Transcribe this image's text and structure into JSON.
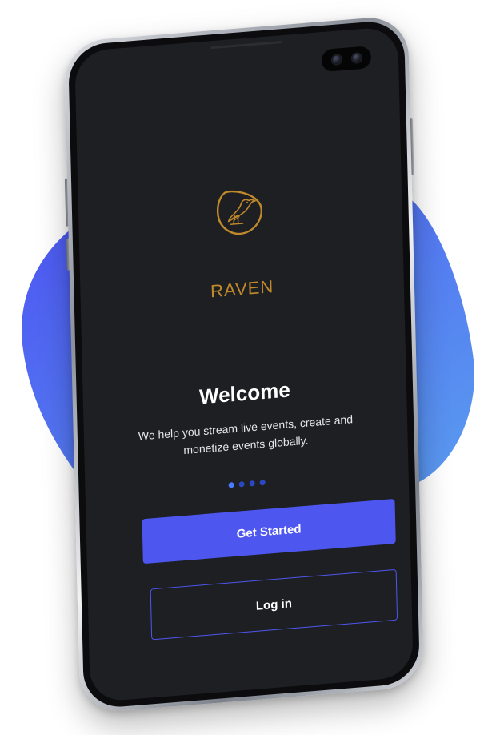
{
  "app": {
    "brand_name": "RAVEN",
    "logo_icon": "raven-bird-icon"
  },
  "onboarding": {
    "title": "Welcome",
    "subtitle": "We help you stream live events, create and monetize events globally.",
    "pagination": {
      "total": 4,
      "current": 1
    }
  },
  "actions": {
    "primary_label": "Get Started",
    "secondary_label": "Log in"
  },
  "colors": {
    "brand_gold": "#c08a2c",
    "accent_blue": "#4e56f0",
    "screen_bg": "#1e1f22",
    "blob_blue": "#4f7df2"
  }
}
